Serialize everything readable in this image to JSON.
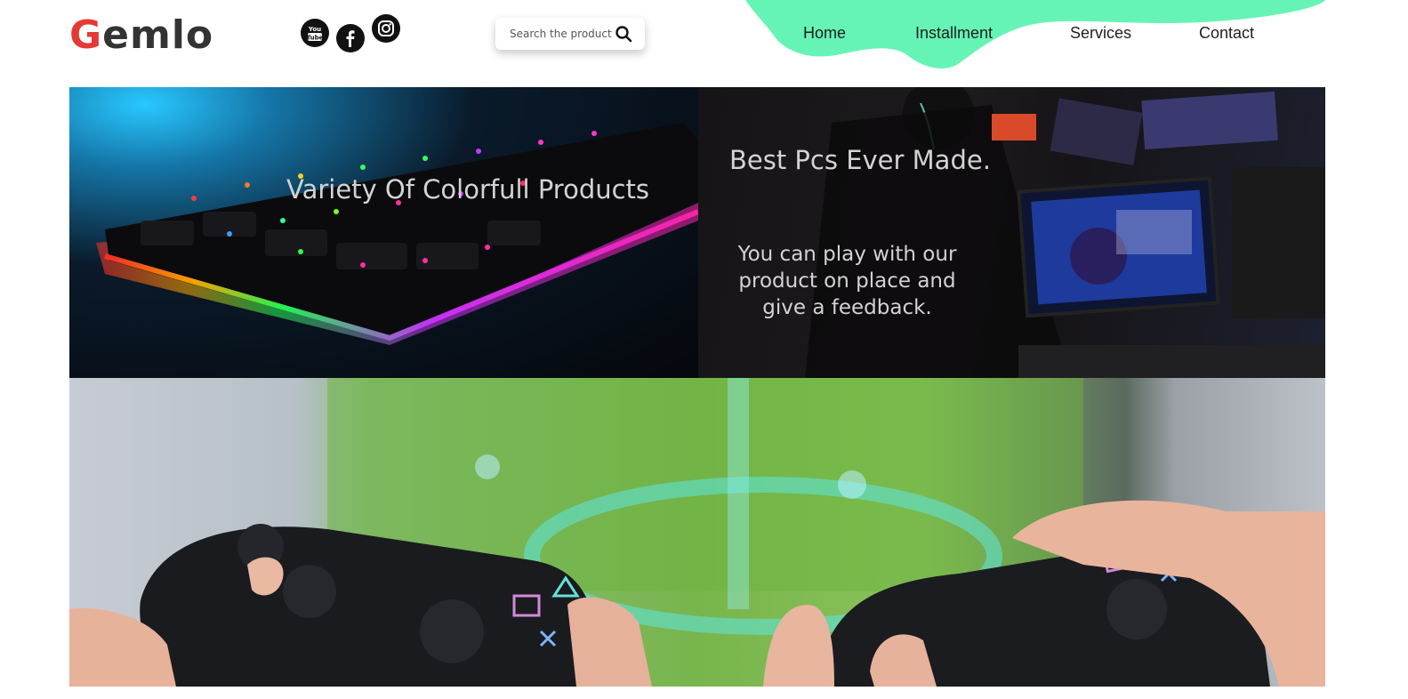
{
  "header": {
    "logo": {
      "first_letter": "G",
      "rest": "emlo"
    },
    "social": [
      {
        "name": "youtube-icon",
        "glyph": "You\nTube"
      },
      {
        "name": "facebook-icon",
        "glyph": "f"
      },
      {
        "name": "instagram-icon",
        "glyph": ""
      }
    ],
    "search": {
      "placeholder": "Search the product",
      "value": ""
    },
    "nav": [
      "Home",
      "Installment",
      "Services",
      "Contact"
    ]
  },
  "hero": {
    "panel1_caption": "Variety Of Colorfull Products",
    "panel2_title": "Best Pcs Ever Made.",
    "panel2_text": "You can play with our product on place and give a feedback."
  },
  "colors": {
    "accent_blob": "#66f4b6",
    "logo_red": "#e53935",
    "caption": "#d3d3d3"
  }
}
